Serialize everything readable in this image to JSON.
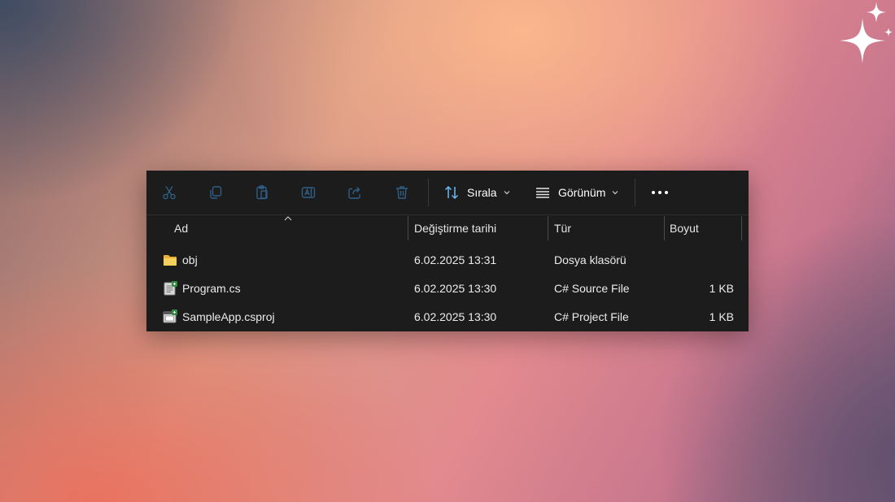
{
  "toolbar": {
    "buttons": [
      {
        "icon": "cut-icon",
        "enabled": false
      },
      {
        "icon": "copy-icon",
        "enabled": false
      },
      {
        "icon": "paste-icon",
        "enabled": false
      },
      {
        "icon": "rename-icon",
        "enabled": false
      },
      {
        "icon": "share-icon",
        "enabled": false
      },
      {
        "icon": "delete-icon",
        "enabled": false
      }
    ],
    "sort_label": "Sırala",
    "view_label": "Görünüm",
    "more_icon": "more-dots-icon"
  },
  "columns": {
    "name": "Ad",
    "date": "Değiştirme tarihi",
    "type": "Tür",
    "size": "Boyut",
    "sorted_by": "name"
  },
  "files": [
    {
      "name": "obj",
      "date": "6.02.2025 13:31",
      "type": "Dosya klasörü",
      "size": "",
      "icon": "folder-icon"
    },
    {
      "name": "Program.cs",
      "date": "6.02.2025 13:30",
      "type": "C# Source File",
      "size": "1 KB",
      "icon": "csharp-file-icon"
    },
    {
      "name": "SampleApp.csproj",
      "date": "6.02.2025 13:30",
      "type": "C# Project File",
      "size": "1 KB",
      "icon": "csproj-file-icon"
    }
  ],
  "colors": {
    "window_bg": "#1c1c1c",
    "disabled_icon": "#2f5f86",
    "folder": "#f4c74a"
  }
}
